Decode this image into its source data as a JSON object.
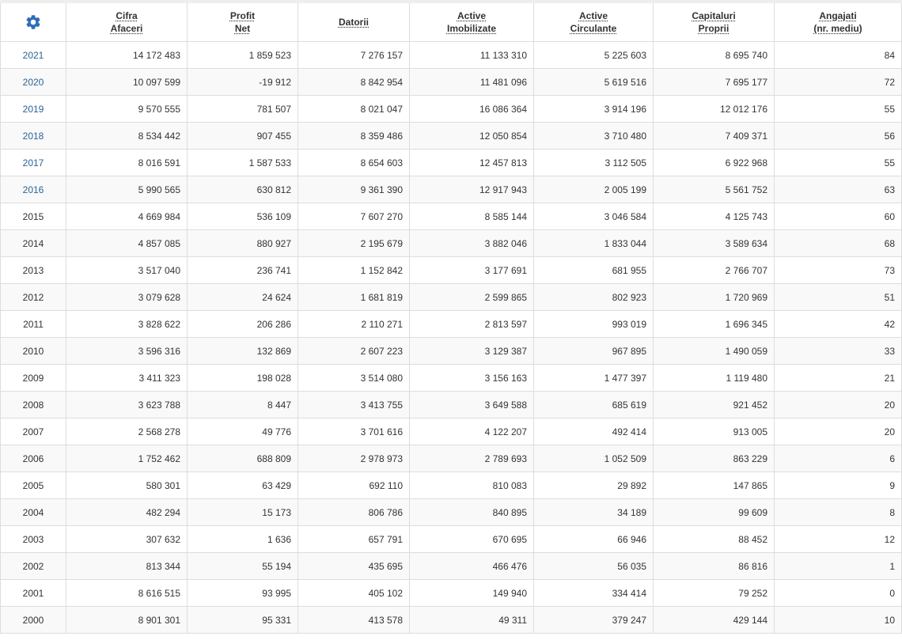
{
  "colors": {
    "accent": "#2a6496",
    "gear": "#2e6db4"
  },
  "header": {
    "settings_icon": "gear-icon",
    "columns": [
      {
        "line1": "Cifra",
        "line2": "Afaceri"
      },
      {
        "line1": "Profit",
        "line2": "Net"
      },
      {
        "line1": "Datorii",
        "line2": ""
      },
      {
        "line1": "Active",
        "line2": "Imobilizate"
      },
      {
        "line1": "Active",
        "line2": "Circulante"
      },
      {
        "line1": "Capitaluri",
        "line2": "Proprii"
      },
      {
        "line1": "Angajati",
        "line2": "(nr. mediu)"
      }
    ]
  },
  "rows": [
    {
      "year": "2021",
      "link": true,
      "values": [
        "14 172 483",
        "1 859 523",
        "7 276 157",
        "11 133 310",
        "5 225 603",
        "8 695 740",
        "84"
      ]
    },
    {
      "year": "2020",
      "link": true,
      "values": [
        "10 097 599",
        "-19 912",
        "8 842 954",
        "11 481 096",
        "5 619 516",
        "7 695 177",
        "72"
      ]
    },
    {
      "year": "2019",
      "link": true,
      "values": [
        "9 570 555",
        "781 507",
        "8 021 047",
        "16 086 364",
        "3 914 196",
        "12 012 176",
        "55"
      ]
    },
    {
      "year": "2018",
      "link": true,
      "values": [
        "8 534 442",
        "907 455",
        "8 359 486",
        "12 050 854",
        "3 710 480",
        "7 409 371",
        "56"
      ]
    },
    {
      "year": "2017",
      "link": true,
      "values": [
        "8 016 591",
        "1 587 533",
        "8 654 603",
        "12 457 813",
        "3 112 505",
        "6 922 968",
        "55"
      ]
    },
    {
      "year": "2016",
      "link": true,
      "values": [
        "5 990 565",
        "630 812",
        "9 361 390",
        "12 917 943",
        "2 005 199",
        "5 561 752",
        "63"
      ]
    },
    {
      "year": "2015",
      "link": false,
      "values": [
        "4 669 984",
        "536 109",
        "7 607 270",
        "8 585 144",
        "3 046 584",
        "4 125 743",
        "60"
      ]
    },
    {
      "year": "2014",
      "link": false,
      "values": [
        "4 857 085",
        "880 927",
        "2 195 679",
        "3 882 046",
        "1 833 044",
        "3 589 634",
        "68"
      ]
    },
    {
      "year": "2013",
      "link": false,
      "values": [
        "3 517 040",
        "236 741",
        "1 152 842",
        "3 177 691",
        "681 955",
        "2 766 707",
        "73"
      ]
    },
    {
      "year": "2012",
      "link": false,
      "values": [
        "3 079 628",
        "24 624",
        "1 681 819",
        "2 599 865",
        "802 923",
        "1 720 969",
        "51"
      ]
    },
    {
      "year": "2011",
      "link": false,
      "values": [
        "3 828 622",
        "206 286",
        "2 110 271",
        "2 813 597",
        "993 019",
        "1 696 345",
        "42"
      ]
    },
    {
      "year": "2010",
      "link": false,
      "values": [
        "3 596 316",
        "132 869",
        "2 607 223",
        "3 129 387",
        "967 895",
        "1 490 059",
        "33"
      ]
    },
    {
      "year": "2009",
      "link": false,
      "values": [
        "3 411 323",
        "198 028",
        "3 514 080",
        "3 156 163",
        "1 477 397",
        "1 119 480",
        "21"
      ]
    },
    {
      "year": "2008",
      "link": false,
      "values": [
        "3 623 788",
        "8 447",
        "3 413 755",
        "3 649 588",
        "685 619",
        "921 452",
        "20"
      ]
    },
    {
      "year": "2007",
      "link": false,
      "values": [
        "2 568 278",
        "49 776",
        "3 701 616",
        "4 122 207",
        "492 414",
        "913 005",
        "20"
      ]
    },
    {
      "year": "2006",
      "link": false,
      "values": [
        "1 752 462",
        "688 809",
        "2 978 973",
        "2 789 693",
        "1 052 509",
        "863 229",
        "6"
      ]
    },
    {
      "year": "2005",
      "link": false,
      "values": [
        "580 301",
        "63 429",
        "692 110",
        "810 083",
        "29 892",
        "147 865",
        "9"
      ]
    },
    {
      "year": "2004",
      "link": false,
      "values": [
        "482 294",
        "15 173",
        "806 786",
        "840 895",
        "34 189",
        "99 609",
        "8"
      ]
    },
    {
      "year": "2003",
      "link": false,
      "values": [
        "307 632",
        "1 636",
        "657 791",
        "670 695",
        "66 946",
        "88 452",
        "12"
      ]
    },
    {
      "year": "2002",
      "link": false,
      "values": [
        "813 344",
        "55 194",
        "435 695",
        "466 476",
        "56 035",
        "86 816",
        "1"
      ]
    },
    {
      "year": "2001",
      "link": false,
      "values": [
        "8 616 515",
        "93 995",
        "405 102",
        "149 940",
        "334 414",
        "79 252",
        "0"
      ]
    },
    {
      "year": "2000",
      "link": false,
      "values": [
        "8 901 301",
        "95 331",
        "413 578",
        "49 311",
        "379 247",
        "429 144",
        "10"
      ]
    }
  ]
}
